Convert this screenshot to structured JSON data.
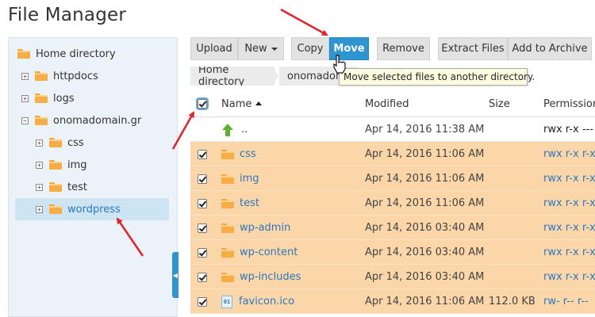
{
  "app": {
    "title": "File Manager"
  },
  "sidebar": {
    "items": [
      {
        "label": "Home directory",
        "expander": ""
      },
      {
        "label": "httpdocs",
        "expander": "+"
      },
      {
        "label": "logs",
        "expander": "+"
      },
      {
        "label": "onomadomain.gr",
        "expander": "−"
      },
      {
        "label": "css",
        "expander": "+"
      },
      {
        "label": "img",
        "expander": "+"
      },
      {
        "label": "test",
        "expander": "+"
      },
      {
        "label": "wordpress",
        "expander": "+"
      }
    ],
    "selected": "wordpress"
  },
  "toolbar": {
    "upload": "Upload",
    "new": "New",
    "copy": "Copy",
    "move": "Move",
    "remove": "Remove",
    "extract": "Extract Files",
    "archive": "Add to Archive"
  },
  "breadcrumb": {
    "items": [
      "Home directory",
      "onomadom"
    ]
  },
  "tooltip": {
    "text": "Move selected files to another directory."
  },
  "table": {
    "headers": {
      "name": "Name",
      "modified": "Modified",
      "size": "Size",
      "permissions": "Permissions"
    },
    "rows": [
      {
        "name": "..",
        "modified": "Apr 14, 2016 11:38 AM",
        "size": "",
        "permissions": "rwx r-x ---",
        "type": "parent",
        "checked": false
      },
      {
        "name": "css",
        "modified": "Apr 14, 2016 11:06 AM",
        "size": "",
        "permissions": "rwx r-x r-x",
        "type": "folder",
        "checked": true
      },
      {
        "name": "img",
        "modified": "Apr 14, 2016 11:06 AM",
        "size": "",
        "permissions": "rwx r-x r-x",
        "type": "folder",
        "checked": true
      },
      {
        "name": "test",
        "modified": "Apr 14, 2016 11:06 AM",
        "size": "",
        "permissions": "rwx r-x r-x",
        "type": "folder",
        "checked": true
      },
      {
        "name": "wp-admin",
        "modified": "Apr 14, 2016 03:40 AM",
        "size": "",
        "permissions": "rwx r-x r-x",
        "type": "folder",
        "checked": true
      },
      {
        "name": "wp-content",
        "modified": "Apr 14, 2016 03:40 AM",
        "size": "",
        "permissions": "rwx r-x r-x",
        "type": "folder",
        "checked": true
      },
      {
        "name": "wp-includes",
        "modified": "Apr 14, 2016 03:40 AM",
        "size": "",
        "permissions": "rwx r-x r-x",
        "type": "folder",
        "checked": true
      },
      {
        "name": "favicon.ico",
        "modified": "Apr 14, 2016 11:06 AM",
        "size": "112.0 KB",
        "permissions": "rw- r-- r--",
        "type": "file",
        "checked": true
      }
    ]
  },
  "colors": {
    "accent": "#2d95d2",
    "selected_row": "#fad6a8",
    "annotation_arrow": "#e8202a"
  }
}
